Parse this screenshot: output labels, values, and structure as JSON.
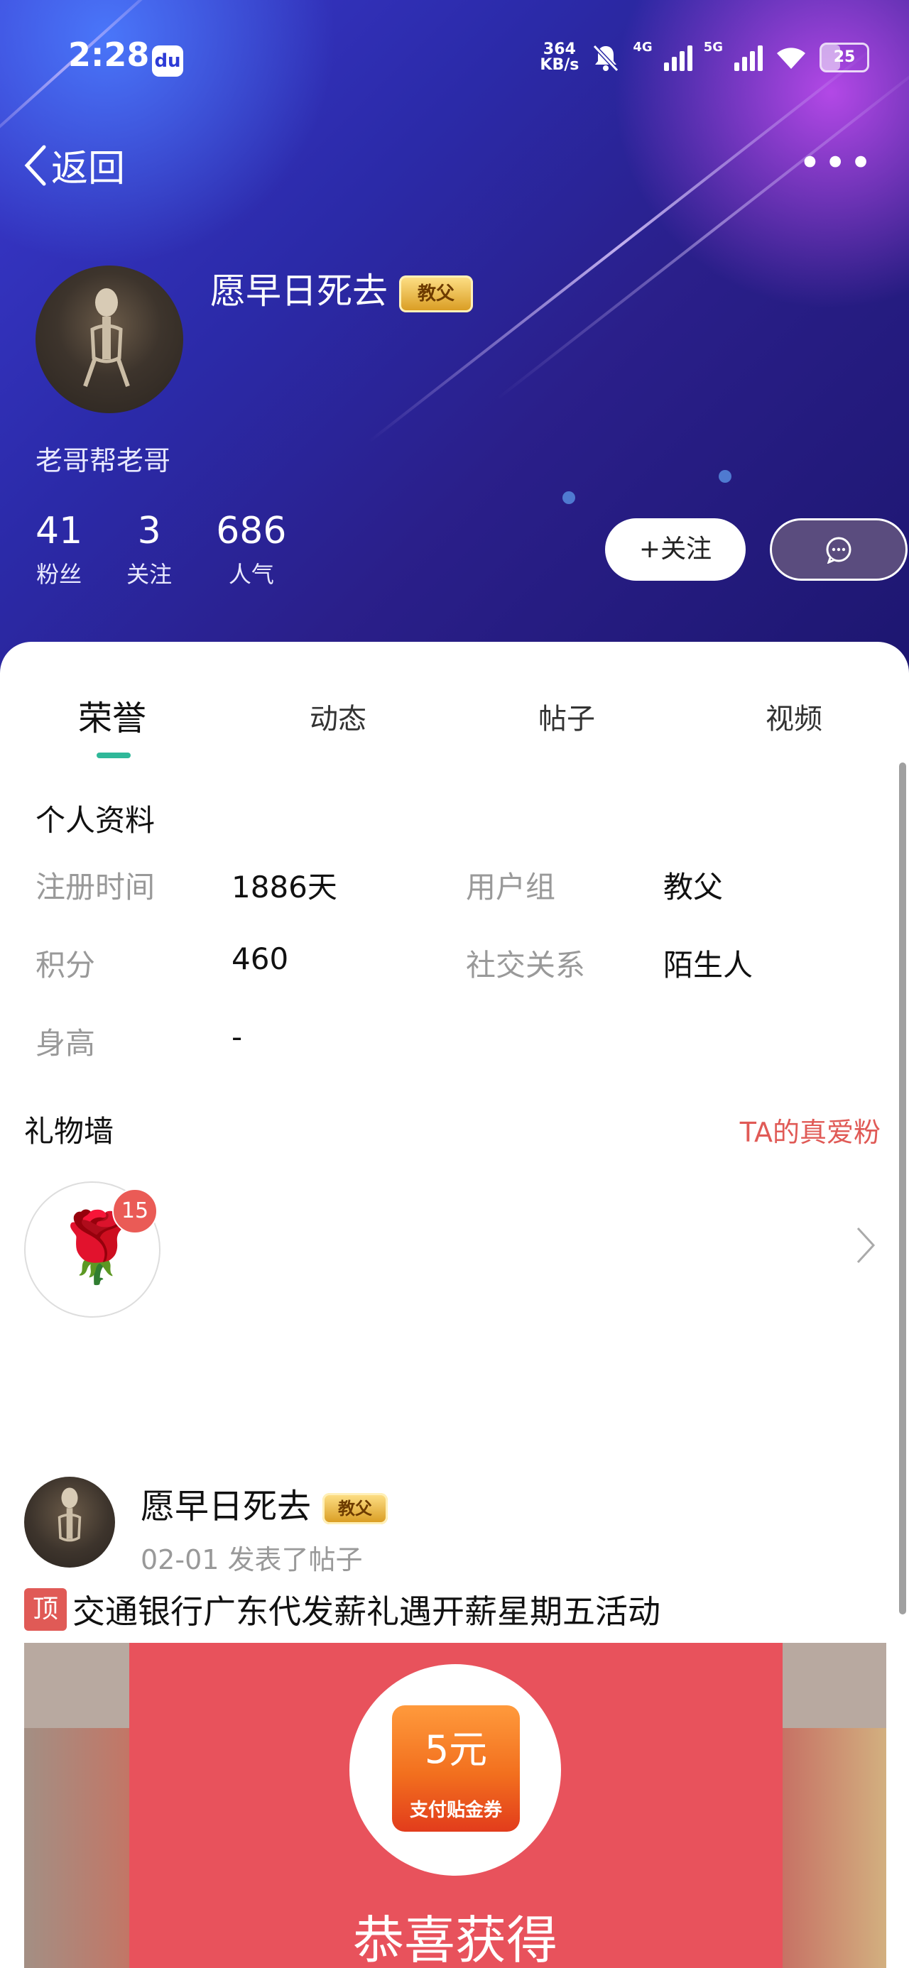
{
  "status_bar": {
    "time": "2:28",
    "speed_value": "364",
    "speed_unit": "KB/s",
    "net1": "4G",
    "net2": "5G",
    "battery": "25"
  },
  "nav": {
    "back_label": "返回",
    "more_label": "•••"
  },
  "profile": {
    "username": "愿早日死去",
    "badge": "教父",
    "signature": "老哥帮老哥",
    "stats": [
      {
        "value": "41",
        "label": "粉丝"
      },
      {
        "value": "3",
        "label": "关注"
      },
      {
        "value": "686",
        "label": "人气"
      }
    ],
    "follow_label": "+关注"
  },
  "tabs": [
    {
      "label": "荣誉",
      "active": true
    },
    {
      "label": "动态",
      "active": false
    },
    {
      "label": "帖子",
      "active": false
    },
    {
      "label": "视频",
      "active": false
    }
  ],
  "personal_info": {
    "title": "个人资料",
    "rows": [
      {
        "k1": "注册时间",
        "v1": "1886天",
        "k2": "用户组",
        "v2": "教父"
      },
      {
        "k1": "积分",
        "v1": "460",
        "k2": "社交关系",
        "v2": "陌生人"
      },
      {
        "k1": "身高",
        "v1": "-"
      }
    ]
  },
  "gift_wall": {
    "title": "礼物墙",
    "fans_link": "TA的真爱粉",
    "gift_count": "15"
  },
  "post": {
    "username": "愿早日死去",
    "badge": "教父",
    "meta": "02-01 发表了帖子",
    "top_tag": "顶",
    "title": "交通银行广东代发薪礼遇开薪星期五活动",
    "image": {
      "coupon_amount": "5元",
      "coupon_desc": "支付贴金券",
      "caption": "恭喜获得"
    }
  },
  "colors": {
    "accent": "#2fb899",
    "link_red": "#e05a56",
    "hero_bg": "#2b2aa8"
  }
}
